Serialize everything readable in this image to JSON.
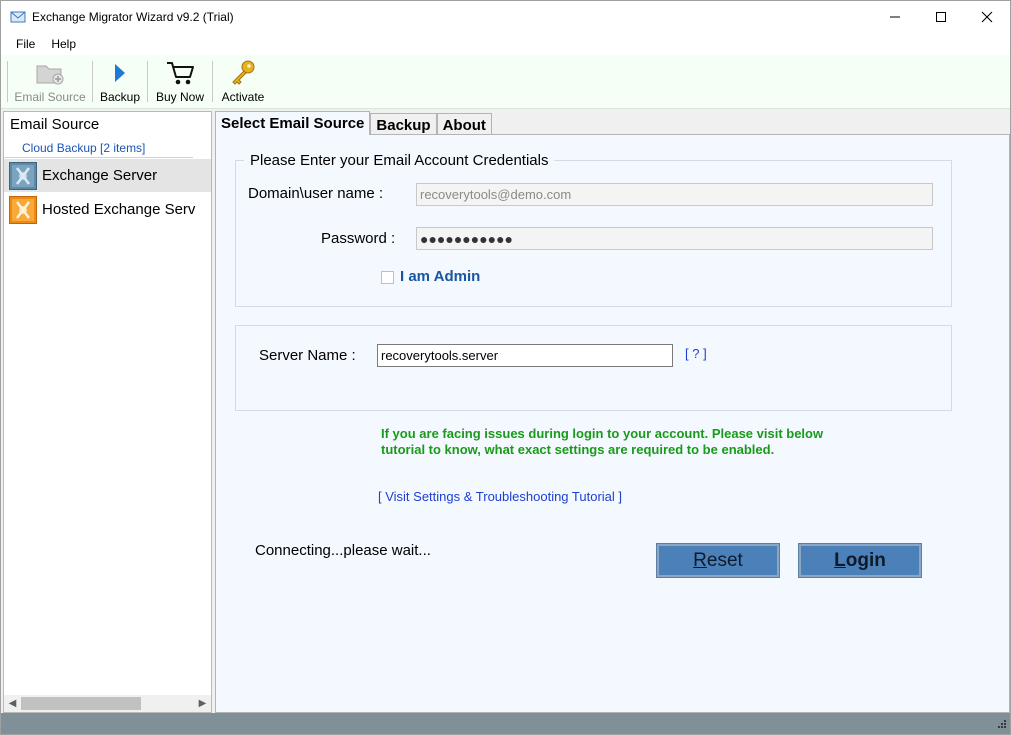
{
  "window": {
    "title": "Exchange Migrator Wizard v9.2 (Trial)"
  },
  "menu": [
    "File",
    "Help"
  ],
  "toolbar": {
    "email_source": "Email Source",
    "backup": "Backup",
    "buy_now": "Buy Now",
    "activate": "Activate"
  },
  "left": {
    "title": "Email Source",
    "cloud": "Cloud Backup [2 items]",
    "items": [
      {
        "label": "Exchange Server",
        "icon": "exchange-server-icon"
      },
      {
        "label": "Hosted Exchange Serv",
        "icon": "hosted-exchange-icon"
      }
    ]
  },
  "tabs": [
    "Select Email Source",
    "Backup",
    "About"
  ],
  "credentials": {
    "title": "Please Enter your Email Account Credentials",
    "user_label": "Domain\\user name :",
    "user_value": "recoverytools@demo.com",
    "password_label": "Password :",
    "password_value": "●●●●●●●●●●●",
    "admin_label": "I am Admin"
  },
  "server": {
    "label": "Server Name :",
    "value": "recoverytools.server",
    "help": "[ ? ]"
  },
  "note": "If you are facing issues during login to your account. Please visit below tutorial to know, what exact settings are required to be enabled.",
  "tutorial": "[ Visit Settings & Troubleshooting Tutorial ]",
  "status": "Connecting...please wait...",
  "buttons": {
    "reset_first": "R",
    "reset_rest": "eset",
    "login_first": "L",
    "login_rest": "ogin"
  }
}
